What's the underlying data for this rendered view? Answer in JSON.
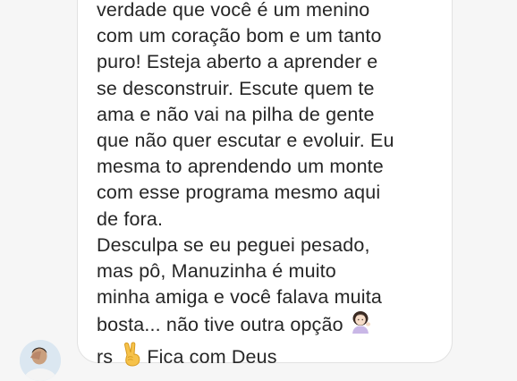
{
  "message": {
    "lines": [
      "verdade que você é um menino",
      "com um coração bom e um tanto",
      "puro! Esteja aberto a aprender e",
      "se desconstruir. Escute quem te",
      "ama e não vai na pilha de gente",
      "que não quer escutar e evoluir. Eu",
      "mesma to aprendendo um monte",
      "com esse programa mesmo aqui",
      "de fora.",
      "Desculpa se eu peguei pesado,",
      "mas pô, Manuzinha é muito",
      "minha amiga e você falava muita",
      "bosta... não tive outra opção"
    ],
    "last_line_start": "rs",
    "last_line_end": "Fica com Deus",
    "emoji_woman_tipping_hand": "woman-tipping-hand-icon",
    "emoji_victory_hand": "victory-hand-icon"
  },
  "sender": {
    "avatar": "sender-avatar"
  },
  "colors": {
    "background": "#f6f6f6",
    "bubble": "#ffffff",
    "bubble_border": "#e2e2e2",
    "text": "#262626"
  }
}
